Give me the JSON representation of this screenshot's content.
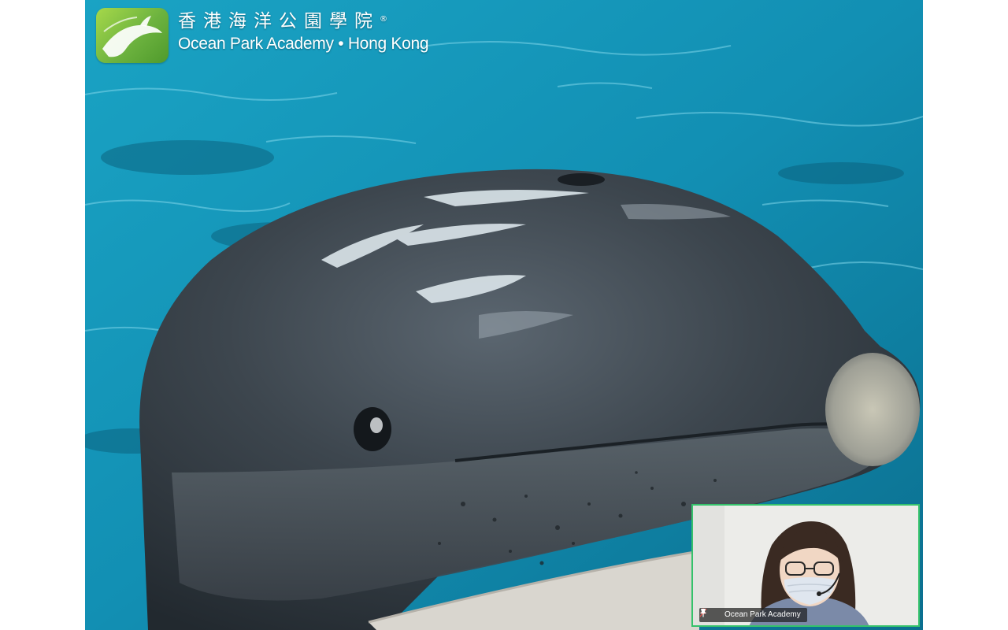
{
  "logo": {
    "chinese_name": "香港海洋公園學院",
    "registered_mark": "®",
    "english_name": "Ocean Park Academy • Hong Kong",
    "icon": "dolphin-logo-icon",
    "color": "#7cc242"
  },
  "main_video": {
    "subject": "dolphin-video-feed"
  },
  "participant": {
    "name": "Ocean Park Academy",
    "mic_icon": "mic-muted-icon",
    "pin_icon": "pin-icon",
    "active_speaker_border": "#35c26b"
  }
}
